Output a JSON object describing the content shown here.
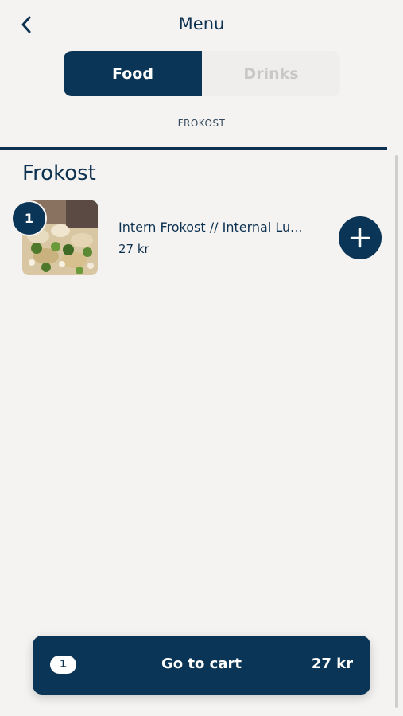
{
  "header": {
    "title": "Menu",
    "back_icon": "chevron-left-icon"
  },
  "tabs": [
    {
      "label": "Food",
      "active": true
    },
    {
      "label": "Drinks",
      "active": false
    }
  ],
  "subnav": {
    "label": "FROKOST"
  },
  "section": {
    "title": "Frokost",
    "items": [
      {
        "name": "Intern Frokost // Internal Lu...",
        "price": "27 kr",
        "quantity": "1",
        "image": "lunch-food-photo",
        "add_icon": "plus-icon"
      }
    ]
  },
  "cart": {
    "count": "1",
    "label": "Go to cart",
    "total": "27 kr"
  },
  "colors": {
    "primary": "#0b3556",
    "background": "#f4f3f1",
    "inactive_tab_text": "#c9c8c6"
  }
}
